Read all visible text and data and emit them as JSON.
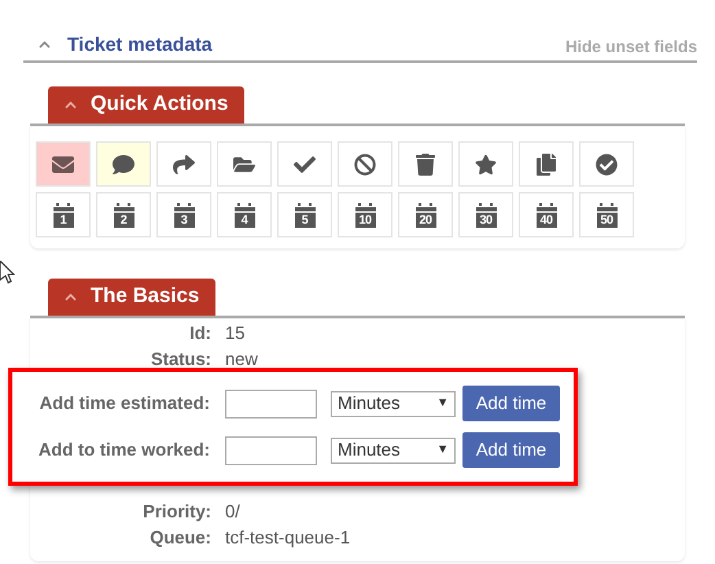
{
  "metadata_header": {
    "title": "Ticket metadata",
    "expanded": true,
    "link": "Hide unset fields"
  },
  "quick_actions": {
    "title": "Quick Actions",
    "expanded": true,
    "actions": [
      {
        "kind": "icon",
        "color": "#ffcccc"
      },
      {
        "kind": "icon",
        "color": "#ffffe0"
      },
      {
        "kind": "icon",
        "color": "#ffffff"
      },
      {
        "kind": "icon",
        "color": "#ffffff"
      },
      {
        "kind": "icon",
        "color": "#ffffff"
      },
      {
        "kind": "icon",
        "color": "#ffffff"
      },
      {
        "kind": "icon",
        "color": "#ffffff"
      },
      {
        "kind": "icon",
        "color": "#ffffff"
      },
      {
        "kind": "icon",
        "color": "#ffffff"
      },
      {
        "kind": "icon",
        "color": "#ffffff"
      },
      {
        "kind": "calendar",
        "label": "1",
        "color": "#ffffff"
      },
      {
        "kind": "calendar",
        "label": "2",
        "color": "#ffffff"
      },
      {
        "kind": "calendar",
        "label": "3",
        "color": "#ffffff"
      },
      {
        "kind": "calendar",
        "label": "4",
        "color": "#ffffff"
      },
      {
        "kind": "calendar",
        "label": "5",
        "color": "#ffffff"
      },
      {
        "kind": "calendar",
        "label": "10",
        "color": "#ffffff"
      },
      {
        "kind": "calendar",
        "label": "20",
        "color": "#ffffff"
      },
      {
        "kind": "calendar",
        "label": "30",
        "color": "#ffffff"
      },
      {
        "kind": "calendar",
        "label": "40",
        "color": "#ffffff"
      },
      {
        "kind": "calendar",
        "label": "50",
        "color": "#ffffff"
      }
    ]
  },
  "basics": {
    "title": "The Basics",
    "expanded": true,
    "fields": [
      {
        "label": "Id:",
        "value": "15"
      },
      {
        "label": "Status:",
        "value": "new"
      },
      {
        "label": "Priority:",
        "value": "0/"
      },
      {
        "label": "Queue:",
        "value": "tcf-test-queue-1"
      }
    ],
    "time_popup": [
      {
        "label": "Add time estimated:",
        "unit": "Minutes",
        "arrow": "▼",
        "button": "Add time"
      },
      {
        "label": "Add to time worked:",
        "unit": "Minutes",
        "arrow": "▼",
        "button": "Add time"
      }
    ]
  }
}
